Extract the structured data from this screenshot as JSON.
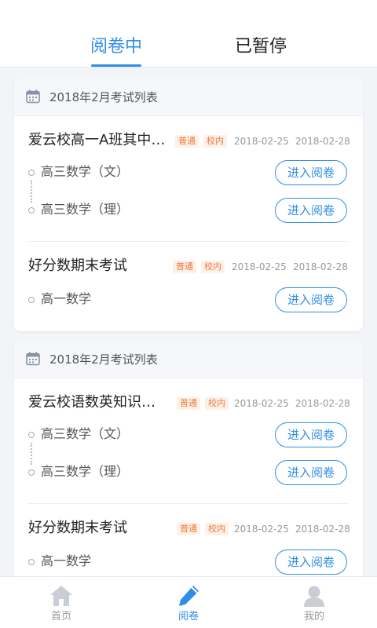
{
  "tabs": {
    "active": "阅卷中",
    "inactive": "已暂停"
  },
  "cards": [
    {
      "header": "2018年2月考试列表",
      "exams": [
        {
          "title": "爱云校高一A班其中…",
          "tags": [
            "普通",
            "校内"
          ],
          "start_date": "2018-02-25",
          "end_date": "2018-02-28",
          "subjects": [
            {
              "name": "高三数学（文）",
              "button": "进入阅卷"
            },
            {
              "name": "高三数学（理）",
              "button": "进入阅卷"
            }
          ]
        },
        {
          "title": "好分数期末考试",
          "tags": [
            "普通",
            "校内"
          ],
          "start_date": "2018-02-25",
          "end_date": "2018-02-28",
          "subjects": [
            {
              "name": "高一数学",
              "button": "进入阅卷"
            }
          ]
        }
      ]
    },
    {
      "header": "2018年2月考试列表",
      "exams": [
        {
          "title": "爱云校语数英知识…",
          "tags": [
            "普通",
            "校内"
          ],
          "start_date": "2018-02-25",
          "end_date": "2018-02-28",
          "subjects": [
            {
              "name": "高三数学（文）",
              "button": "进入阅卷"
            },
            {
              "name": "高三数学（理）",
              "button": "进入阅卷"
            }
          ]
        },
        {
          "title": "好分数期末考试",
          "tags": [
            "普通",
            "校内"
          ],
          "start_date": "2018-02-25",
          "end_date": "2018-02-28",
          "subjects": [
            {
              "name": "高一数学",
              "button": "进入阅卷"
            }
          ]
        }
      ]
    }
  ],
  "nav": {
    "items": [
      {
        "label": "首页",
        "icon": "home-icon",
        "active": false
      },
      {
        "label": "阅卷",
        "icon": "pencil-icon",
        "active": true
      },
      {
        "label": "我的",
        "icon": "user-icon",
        "active": false
      }
    ]
  },
  "colors": {
    "accent": "#2f8ee9",
    "tag_text": "#f07b3f",
    "tag_bg": "#fdf0e6",
    "inactive_icon": "#c8cdd6"
  }
}
